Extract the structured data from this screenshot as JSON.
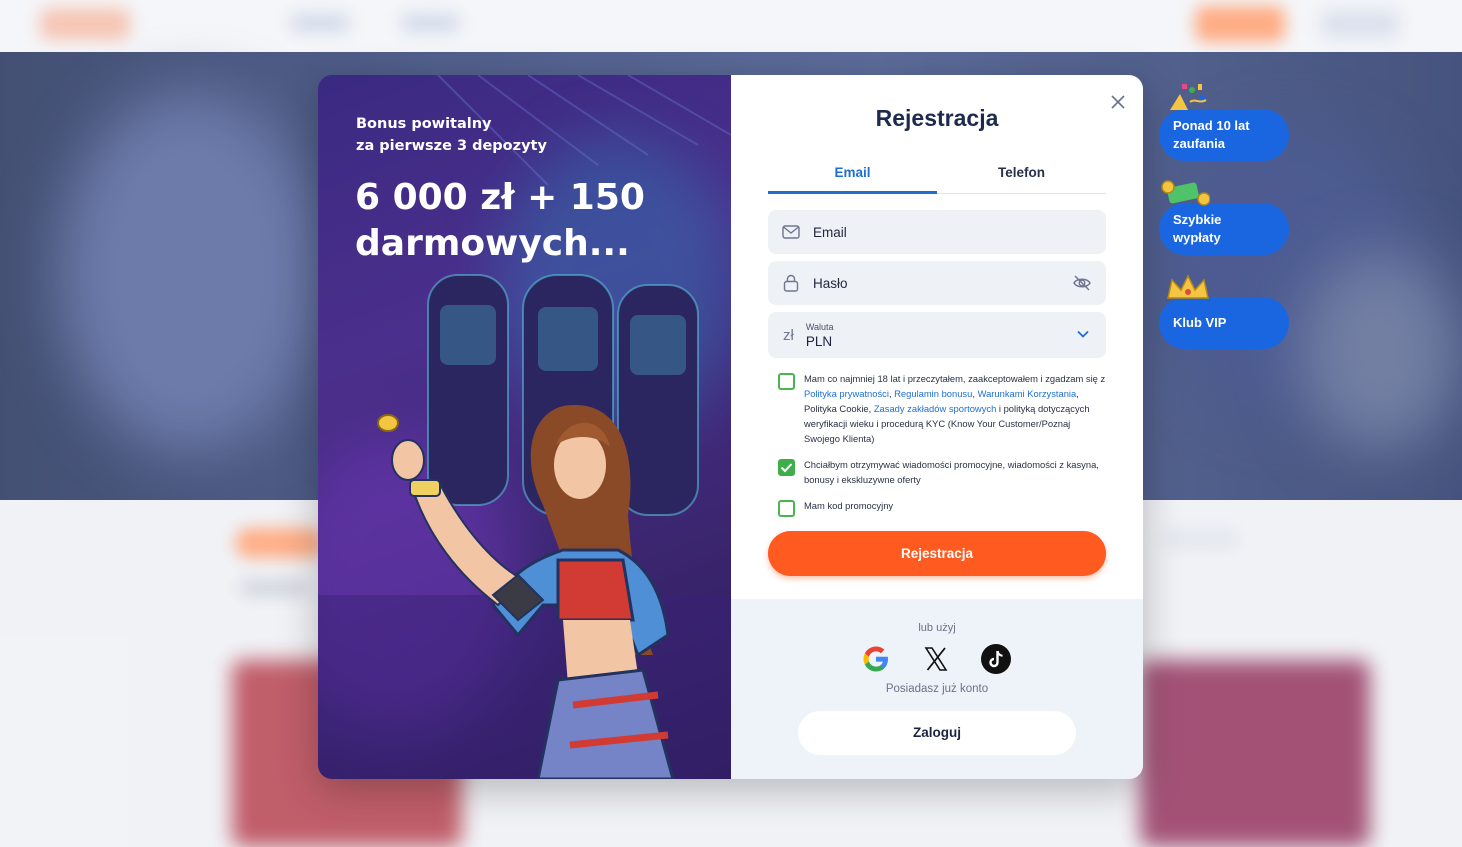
{
  "promo": {
    "subtitle_line1": "Bonus powitalny",
    "subtitle_line2": "za pierwsze 3 depozyty",
    "title_line1": "6 000 zł + 150",
    "title_line2": "darmowych..."
  },
  "form": {
    "title": "Rejestracja",
    "tabs": [
      {
        "label": "Email",
        "active": true
      },
      {
        "label": "Telefon",
        "active": false
      }
    ],
    "email_placeholder": "Email",
    "password_placeholder": "Hasło",
    "currency": {
      "symbol": "zł",
      "caption": "Waluta",
      "value": "PLN"
    },
    "consent": {
      "checked": false,
      "part1": "Mam co najmniej 18 lat i przeczytałem, zaakceptowałem i zgadzam się z ",
      "link1": "Polityka prywatności",
      "sep1": ", ",
      "link2": "Regulamin bonusu",
      "sep2": ", ",
      "link3": "Warunkami Korzystania",
      "part2": ", Polityka Cookie, ",
      "link4": "Zasady zakładów sportowych",
      "part3": " i polityką dotyczących weryfikacji wieku i procedurą KYC (Know Your Customer/Poznaj Swojego Klienta)"
    },
    "marketing": {
      "checked": true,
      "text": "Chciałbym otrzymywać wiadomości promocyjne, wiadomości z kasyna, bonusy i ekskluzywne oferty"
    },
    "promo_code": {
      "checked": false,
      "text": "Mam kod promocyjny"
    },
    "submit_label": "Rejestracja",
    "or_text": "lub użyj",
    "social": [
      "google-icon",
      "x-icon",
      "tiktok-icon"
    ],
    "have_account_text": "Posiadasz już konto",
    "login_label": "Zaloguj"
  },
  "badges": [
    {
      "line1": "Ponad 10 lat",
      "line2": "zaufania",
      "icon": "confetti-icon"
    },
    {
      "line1": "Szybkie",
      "line2": "wypłaty",
      "icon": "money-icon"
    },
    {
      "line1": "Klub VIP",
      "line2": "",
      "icon": "crown-icon"
    }
  ],
  "colors": {
    "accent_orange": "#ff5a1f",
    "brand_blue": "#1a66e0",
    "tab_blue": "#1f6fd1",
    "check_green": "#3fae4a"
  }
}
